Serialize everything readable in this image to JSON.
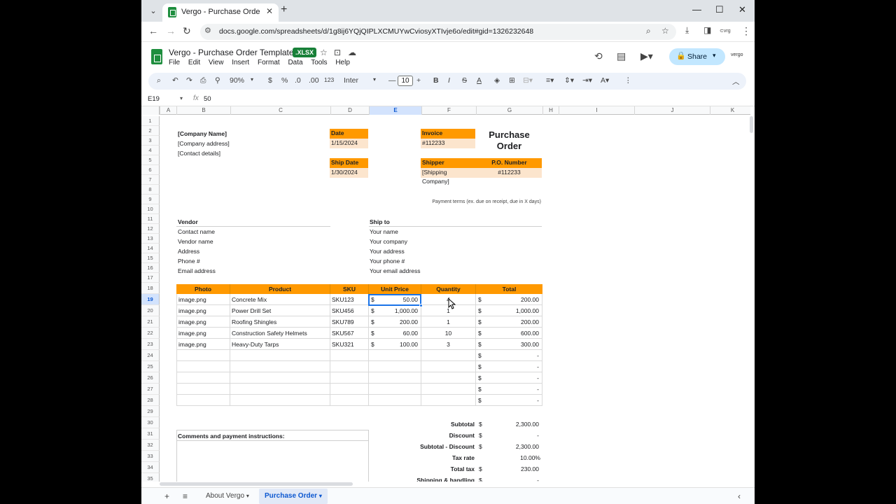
{
  "browser": {
    "tab_title": "Vergo - Purchase Order Templa",
    "url": "docs.google.com/spreadsheets/d/1g8ij6YQjQIPLXCMUYwCviosyXTIvje6o/edit#gid=1326232648",
    "new_tab_symbol": "+",
    "close_symbol": "✕",
    "win_min": "—",
    "win_max": "☐",
    "win_close": "✕"
  },
  "doc": {
    "title": "Vergo - Purchase Order Template",
    "badge": ".XLSX",
    "menu": [
      "File",
      "Edit",
      "View",
      "Insert",
      "Format",
      "Data",
      "Tools",
      "Help"
    ],
    "share_label": "Share",
    "brand": "vergo"
  },
  "toolbar": {
    "zoom": "90%",
    "currency": "$",
    "percent": "%",
    "dec_decrease": ".0",
    "dec_increase": ".00",
    "number_format": "123",
    "font": "Inter",
    "font_size": "10",
    "bold": "B",
    "italic": "I",
    "strike": "S",
    "text_color": "A"
  },
  "formula_bar": {
    "cell_ref": "E19",
    "fx": "fx",
    "value": "50"
  },
  "columns": [
    "A",
    "B",
    "C",
    "D",
    "E",
    "F",
    "G",
    "H",
    "I",
    "J",
    "K"
  ],
  "rows": [
    "1",
    "2",
    "3",
    "4",
    "5",
    "6",
    "7",
    "8",
    "9",
    "10",
    "11",
    "12",
    "13",
    "14",
    "15",
    "16",
    "17",
    "18",
    "19",
    "20",
    "21",
    "22",
    "23",
    "24",
    "25",
    "26",
    "27",
    "28",
    "29",
    "30",
    "31",
    "32",
    "33",
    "34",
    "35"
  ],
  "company": {
    "name": "[Company Name]",
    "address": "[Company address]",
    "contact": "[Contact details]"
  },
  "doc_title": "Purchase Order",
  "fields": {
    "date_label": "Date",
    "date_value": "1/15/2024",
    "ship_date_label": "Ship Date",
    "ship_date_value": "1/30/2024",
    "invoice_label": "Invoice",
    "invoice_value": "#112233",
    "shipper_label": "Shipper",
    "shipper_value": "[Shipping Company]",
    "po_label": "P.O. Number",
    "po_value": "#112233"
  },
  "payment_terms": "Payment terms (ex. due on receipt, due in X days)",
  "vendor": {
    "title": "Vendor",
    "lines": [
      "Contact name",
      "Vendor name",
      "Address",
      "Phone #",
      "Email address"
    ]
  },
  "ship_to": {
    "title": "Ship to",
    "lines": [
      "Your name",
      "Your company",
      "Your address",
      "Your phone #",
      "Your email address"
    ]
  },
  "table": {
    "headers": [
      "Photo",
      "Product",
      "SKU",
      "Unit Price",
      "Quantity",
      "Total"
    ],
    "currency_symbol": "$",
    "rows": [
      {
        "photo": "image.png",
        "product": "Concrete Mix",
        "sku": "SKU123",
        "price": "50.00",
        "qty": "4",
        "total": "200.00"
      },
      {
        "photo": "image.png",
        "product": "Power Drill Set",
        "sku": "SKU456",
        "price": "1,000.00",
        "qty": "1",
        "total": "1,000.00"
      },
      {
        "photo": "image.png",
        "product": "Roofing Shingles",
        "sku": "SKU789",
        "price": "200.00",
        "qty": "1",
        "total": "200.00"
      },
      {
        "photo": "image.png",
        "product": "Construction Safety Helmets",
        "sku": "SKU567",
        "price": "60.00",
        "qty": "10",
        "total": "600.00"
      },
      {
        "photo": "image.png",
        "product": "Heavy-Duty Tarps",
        "sku": "SKU321",
        "price": "100.00",
        "qty": "3",
        "total": "300.00"
      },
      {
        "photo": "",
        "product": "",
        "sku": "",
        "price": "",
        "qty": "",
        "total": "-"
      },
      {
        "photo": "",
        "product": "",
        "sku": "",
        "price": "",
        "qty": "",
        "total": "-"
      },
      {
        "photo": "",
        "product": "",
        "sku": "",
        "price": "",
        "qty": "",
        "total": "-"
      },
      {
        "photo": "",
        "product": "",
        "sku": "",
        "price": "",
        "qty": "",
        "total": "-"
      },
      {
        "photo": "",
        "product": "",
        "sku": "",
        "price": "",
        "qty": "",
        "total": "-"
      }
    ]
  },
  "comments_title": "Comments and payment instructions:",
  "summary": [
    {
      "label": "Subtotal",
      "cur": "$",
      "value": "2,300.00"
    },
    {
      "label": "Discount",
      "cur": "$",
      "value": "-"
    },
    {
      "label": "Subtotal - Discount",
      "cur": "$",
      "value": "2,300.00"
    },
    {
      "label": "Tax rate",
      "cur": "",
      "value": "10.00%"
    },
    {
      "label": "Total tax",
      "cur": "$",
      "value": "230.00"
    },
    {
      "label": "Shipping & handling",
      "cur": "$",
      "value": "-"
    }
  ],
  "sheets": {
    "tab1": "About Vergo",
    "tab2": "Purchase Order"
  },
  "colors": {
    "header_orange": "#ff9900",
    "value_peach": "#fce5cd",
    "selection_blue": "#1a73e8",
    "sheets_green": "#1e8e3e"
  }
}
